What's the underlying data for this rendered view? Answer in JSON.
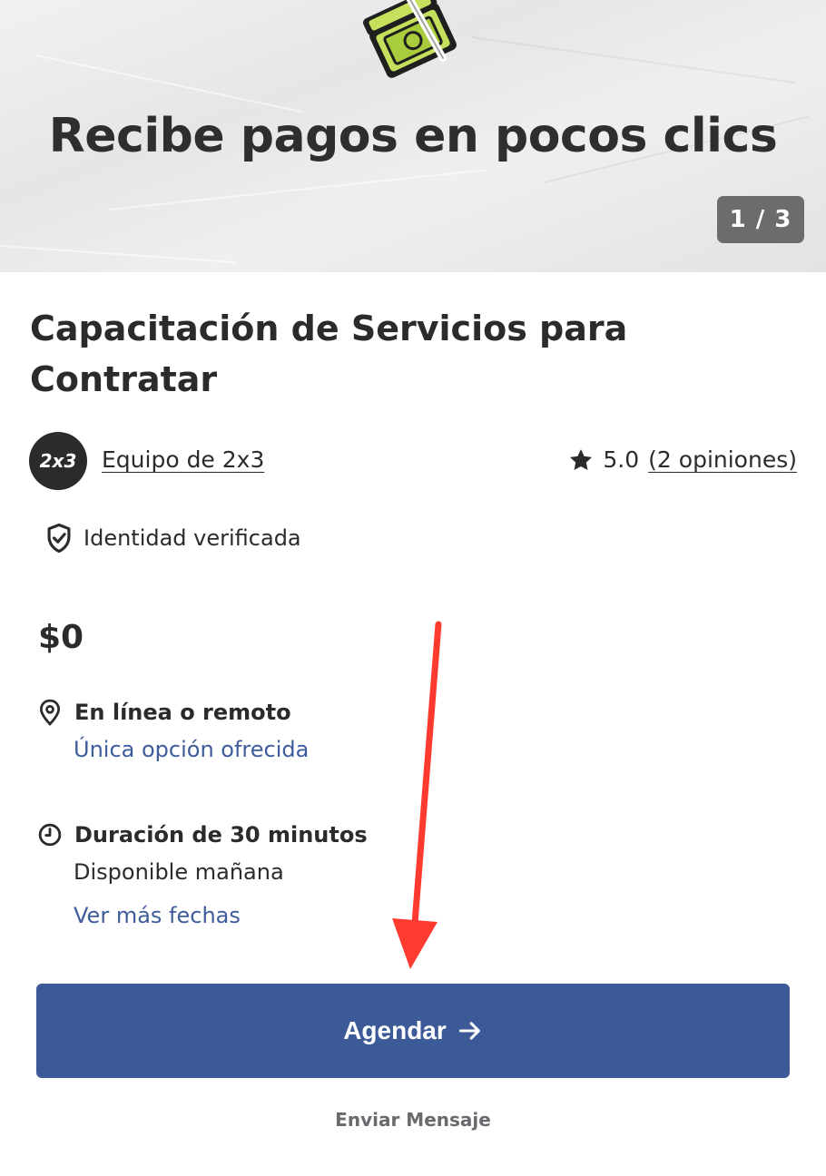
{
  "hero": {
    "title": "Recibe pagos en pocos clics",
    "counter": "1 / 3",
    "graphic": "cash-money-icon"
  },
  "service": {
    "title": "Capacitación de Servicios para Contratar",
    "provider": {
      "avatar_text": "2x3",
      "name": "Equipo de 2x3"
    },
    "rating": {
      "score": "5.0",
      "reviews_prefix": "(",
      "reviews_label": "2 opiniones",
      "reviews_suffix": ")",
      "icon": "star-icon"
    },
    "verified": {
      "label": "Identidad verificada",
      "icon": "shield-check-icon"
    },
    "price": "$0",
    "location": {
      "icon": "map-pin-icon",
      "label": "En línea o remoto",
      "note": "Única opción ofrecida"
    },
    "duration": {
      "icon": "clock-icon",
      "label": "Duración de 30 minutos",
      "availability": "Disponible mañana",
      "more_dates": "Ver más fechas"
    }
  },
  "actions": {
    "primary_label": "Agendar",
    "primary_icon": "arrow-right-icon",
    "secondary_label": "Enviar Mensaje"
  },
  "colors": {
    "primary": "#3c5a98",
    "link": "#3e5c9c",
    "text": "#2b2b2e",
    "annotation": "#ff3b30"
  }
}
